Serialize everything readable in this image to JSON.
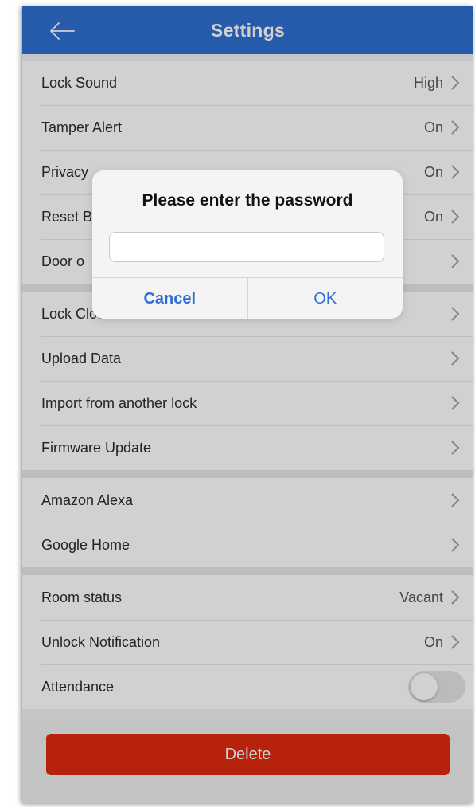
{
  "header": {
    "title": "Settings",
    "back_icon": "arrow-left-icon",
    "color": "#2f6fd2"
  },
  "groups": [
    {
      "rows": [
        {
          "label": "Lock Sound",
          "value": "High"
        },
        {
          "label": "Tamper Alert",
          "value": "On"
        },
        {
          "label": "Privacy",
          "value": "On"
        },
        {
          "label": "Reset B",
          "value": "On"
        },
        {
          "label": "Door o",
          "value": ""
        }
      ]
    },
    {
      "rows": [
        {
          "label": "Lock Clock",
          "value": ""
        },
        {
          "label": "Upload Data",
          "value": ""
        },
        {
          "label": "Import from another lock",
          "value": ""
        },
        {
          "label": "Firmware Update",
          "value": ""
        }
      ]
    },
    {
      "rows": [
        {
          "label": "Amazon Alexa",
          "value": ""
        },
        {
          "label": "Google Home",
          "value": ""
        }
      ]
    },
    {
      "rows": [
        {
          "label": "Room status",
          "value": "Vacant"
        },
        {
          "label": "Unlock Notification",
          "value": "On"
        },
        {
          "label": "Attendance",
          "toggle": false
        }
      ]
    }
  ],
  "footer": {
    "delete_label": "Delete",
    "delete_color": "#e02a10"
  },
  "dialog": {
    "title": "Please enter the password",
    "input_value": "",
    "cancel_label": "Cancel",
    "ok_label": "OK"
  }
}
